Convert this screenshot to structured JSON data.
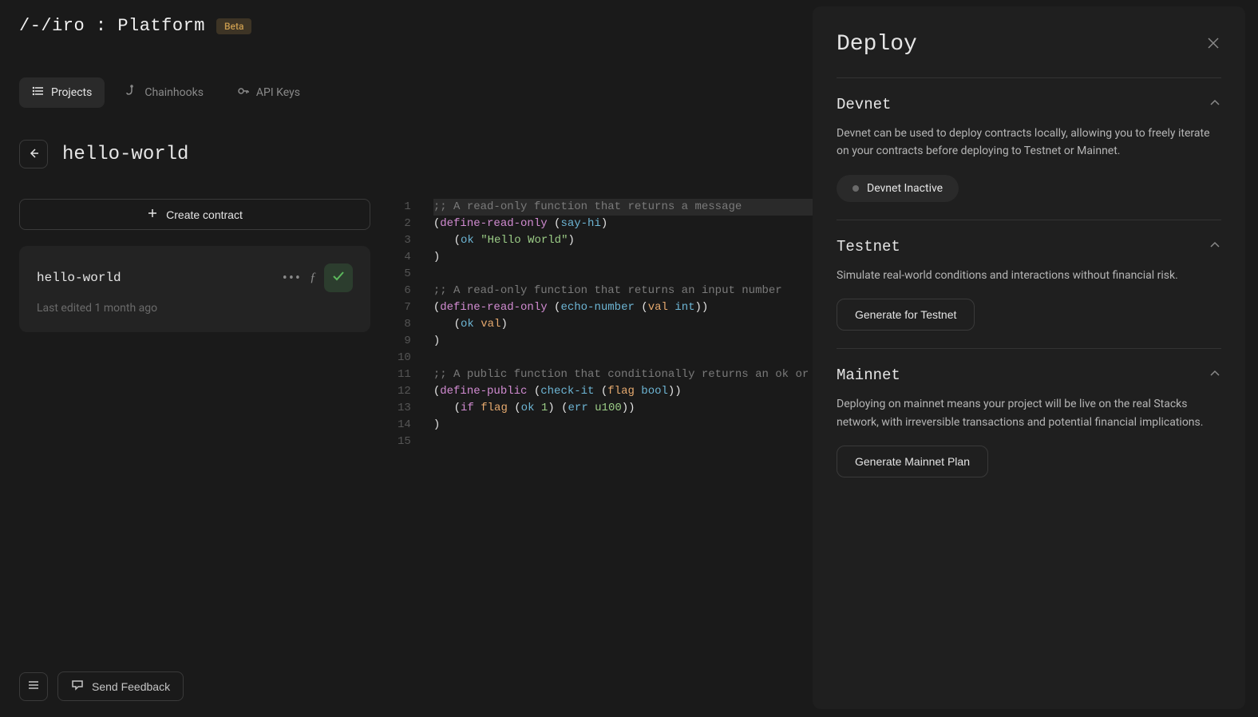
{
  "header": {
    "logo": "/-/iro : Platform",
    "badge": "Beta"
  },
  "nav": {
    "projects": "Projects",
    "chainhooks": "Chainhooks",
    "api_keys": "API Keys"
  },
  "project": {
    "title": "hello-world",
    "devnet_status": "Devnet Inactive"
  },
  "sidebar": {
    "create_btn": "Create contract",
    "file": {
      "name": "hello-world",
      "meta": "Last edited 1 month ago"
    }
  },
  "editor": {
    "lines": [
      {
        "n": "1",
        "type": "comment",
        "text": ";; A read-only function that returns a message",
        "highlight": true
      },
      {
        "n": "2",
        "type": "code",
        "indent": 0
      },
      {
        "n": "3",
        "type": "code",
        "indent": 1
      },
      {
        "n": "4",
        "type": "code",
        "indent": 0
      },
      {
        "n": "5",
        "type": "blank"
      },
      {
        "n": "6",
        "type": "comment",
        "text": ";; A read-only function that returns an input number"
      },
      {
        "n": "7",
        "type": "code",
        "indent": 0
      },
      {
        "n": "8",
        "type": "code",
        "indent": 1
      },
      {
        "n": "9",
        "type": "code",
        "indent": 0
      },
      {
        "n": "10",
        "type": "blank"
      },
      {
        "n": "11",
        "type": "comment",
        "text": ";; A public function that conditionally returns an ok or an error"
      },
      {
        "n": "12",
        "type": "code",
        "indent": 0
      },
      {
        "n": "13",
        "type": "code",
        "indent": 1
      },
      {
        "n": "14",
        "type": "code",
        "indent": 0
      },
      {
        "n": "15",
        "type": "blank"
      }
    ],
    "tokens": {
      "define_read_only": "define-read-only",
      "define_public": "define-public",
      "say_hi": "say-hi",
      "echo_number": "echo-number",
      "check_it": "check-it",
      "ok": "ok",
      "err": "err",
      "if": "if",
      "val": "val",
      "flag": "flag",
      "int": "int",
      "bool": "bool",
      "hello_world": "\"Hello World\"",
      "one": "1",
      "u100": "u100"
    }
  },
  "panel": {
    "title": "Deploy",
    "devnet": {
      "title": "Devnet",
      "desc": "Devnet can be used to deploy contracts locally, allowing you to freely iterate on your contracts before deploying to Testnet or Mainnet.",
      "status": "Devnet Inactive"
    },
    "testnet": {
      "title": "Testnet",
      "desc": "Simulate real-world conditions and interactions without financial risk.",
      "action": "Generate for Testnet"
    },
    "mainnet": {
      "title": "Mainnet",
      "desc": "Deploying on mainnet means your project will be live on the real Stacks network, with irreversible transactions and potential financial implications.",
      "action": "Generate Mainnet Plan"
    }
  },
  "bottom": {
    "feedback": "Send Feedback"
  }
}
